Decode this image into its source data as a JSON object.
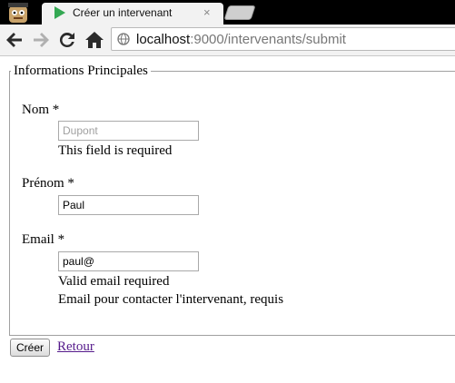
{
  "browser": {
    "tab_title": "Créer un intervenant",
    "tab_close": "×",
    "url_host": "localhost",
    "url_path": ":9000/intervenants/submit"
  },
  "form": {
    "legend": "Informations Principales",
    "nom": {
      "label": "Nom *",
      "value": "",
      "placeholder": "Dupont",
      "error": "This field is required"
    },
    "prenom": {
      "label": "Prénom *",
      "value": "Paul"
    },
    "email": {
      "label": "Email *",
      "value": "paul@",
      "error": "Valid email required",
      "help": "Email pour contacter l'intervenant, requis"
    },
    "submit_label": "Créer",
    "back_label": "Retour"
  }
}
